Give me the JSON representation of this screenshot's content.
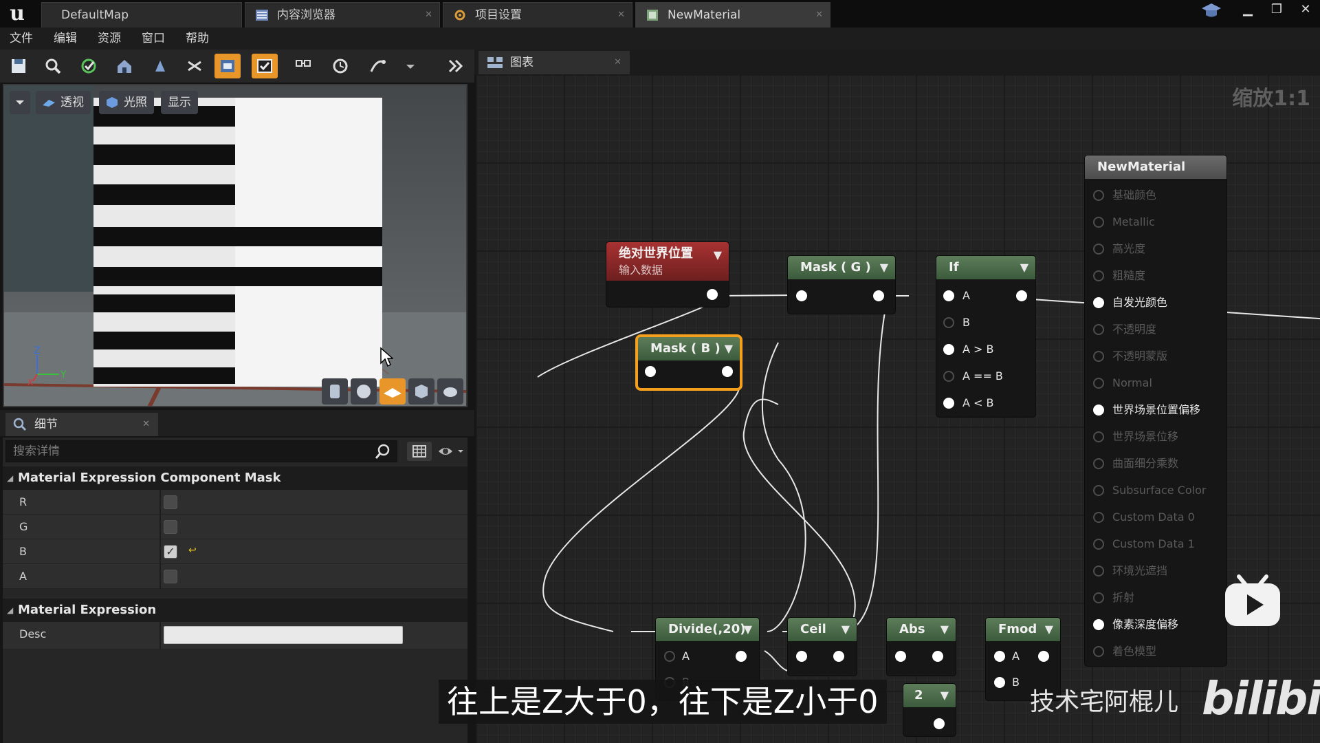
{
  "tabs": [
    {
      "label": "DefaultMap",
      "closable": false
    },
    {
      "label": "内容浏览器",
      "closable": true
    },
    {
      "label": "项目设置",
      "closable": true
    },
    {
      "label": "NewMaterial",
      "closable": true,
      "active": true
    }
  ],
  "menu": [
    "文件",
    "编辑",
    "资源",
    "窗口",
    "帮助"
  ],
  "toolbar": {
    "icons": [
      "save-icon",
      "browse-icon",
      "apply-icon",
      "home-icon",
      "clean-icon",
      "find-icon",
      "hierarchy-icon",
      "live-update-icon",
      "stats-icon",
      "platform-stats-icon",
      "mobile-icon",
      "settings-icon",
      "more-icon"
    ]
  },
  "viewport": {
    "perspective_label": "透视",
    "lit_label": "光照",
    "show_label": "显示",
    "axis_z": "Z",
    "axis_y": "Y",
    "axis_x": "X"
  },
  "details": {
    "tab_label": "细节",
    "search_placeholder": "搜索详情",
    "category1": "Material Expression Component Mask",
    "props": [
      {
        "label": "R",
        "checked": false
      },
      {
        "label": "G",
        "checked": false
      },
      {
        "label": "B",
        "checked": true
      },
      {
        "label": "A",
        "checked": false
      }
    ],
    "category2": "Material Expression",
    "desc_label": "Desc"
  },
  "graph": {
    "tab_label": "图表",
    "zoom": "缩放1:1",
    "nodes": {
      "world_pos": {
        "title": "绝对世界位置",
        "subtitle": "输入数据"
      },
      "mask_g": {
        "title": "Mask ( G )"
      },
      "mask_b": {
        "title": "Mask ( B )"
      },
      "if_node": {
        "title": "If",
        "pins": [
          "A",
          "B",
          "A > B",
          "A == B",
          "A < B"
        ]
      },
      "divide": {
        "title": "Divide(,20)",
        "pins": [
          "A",
          "B"
        ]
      },
      "ceil": {
        "title": "Ceil"
      },
      "abs": {
        "title": "Abs"
      },
      "fmod": {
        "title": "Fmod",
        "pins": [
          "A",
          "B"
        ]
      },
      "const2": {
        "title": "2"
      }
    },
    "result": {
      "title": "NewMaterial",
      "pins": [
        {
          "label": "基础颜色",
          "active": false
        },
        {
          "label": "Metallic",
          "active": false
        },
        {
          "label": "高光度",
          "active": false
        },
        {
          "label": "粗糙度",
          "active": false
        },
        {
          "label": "自发光颜色",
          "active": true
        },
        {
          "label": "不透明度",
          "active": false
        },
        {
          "label": "不透明蒙版",
          "active": false
        },
        {
          "label": "Normal",
          "active": false
        },
        {
          "label": "世界场景位置偏移",
          "active": true
        },
        {
          "label": "世界场景位移",
          "active": false
        },
        {
          "label": "曲面细分乘数",
          "active": false
        },
        {
          "label": "Subsurface Color",
          "active": false
        },
        {
          "label": "Custom Data 0",
          "active": false
        },
        {
          "label": "Custom Data 1",
          "active": false
        },
        {
          "label": "环境光遮挡",
          "active": false
        },
        {
          "label": "折射",
          "active": false
        },
        {
          "label": "像素深度偏移",
          "active": true
        },
        {
          "label": "着色模型",
          "active": false
        }
      ]
    }
  },
  "overlay": {
    "subtitle": "往上是Z大于0，往下是Z小于0",
    "author": "技术宅阿棍儿",
    "logo": "bilibili"
  },
  "colors": {
    "accent": "#e8962a",
    "node_header": "#4d6b4a",
    "input_node": "#a83232",
    "selection": "#f5a01c"
  }
}
